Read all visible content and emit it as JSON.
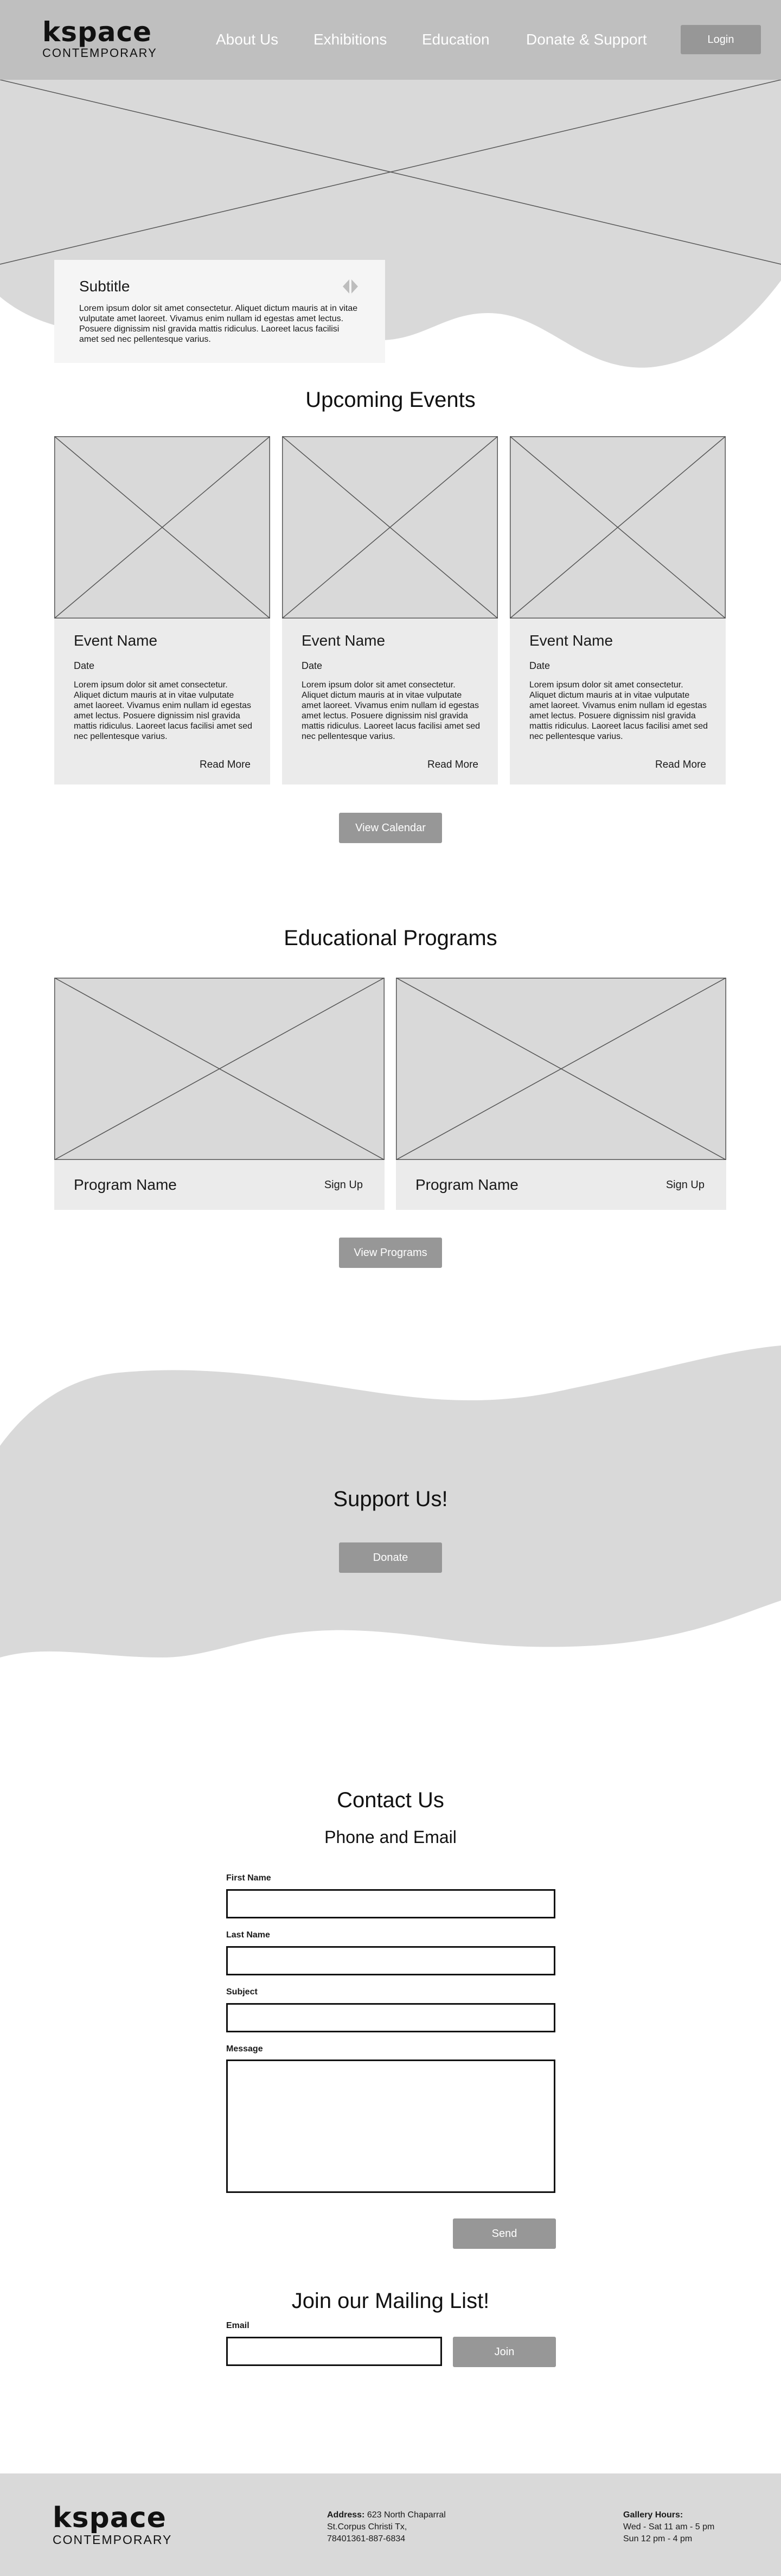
{
  "header": {
    "logo_main": "kspace",
    "logo_sub": "CONTEMPORARY",
    "nav": [
      {
        "label": "About Us"
      },
      {
        "label": "Exhibitions"
      },
      {
        "label": "Education"
      },
      {
        "label": "Donate & Support"
      }
    ],
    "login_label": "Login"
  },
  "hero": {
    "subtitle": "Subtitle",
    "text": "Lorem ipsum dolor sit amet consectetur. Aliquet dictum mauris at in vitae vulputate amet laoreet. Vivamus enim nullam id egestas amet lectus. Posuere dignissim nisl gravida mattis ridiculus. Laoreet lacus facilisi amet sed nec pellentesque varius."
  },
  "events": {
    "title": "Upcoming Events",
    "items": [
      {
        "name": "Event Name",
        "date": "Date",
        "text": "Lorem ipsum dolor sit amet consectetur. Aliquet dictum mauris at in vitae vulputate amet laoreet. Vivamus enim nullam id egestas amet lectus. Posuere dignissim nisl gravida mattis ridiculus. Laoreet lacus facilisi amet sed nec pellentesque varius.",
        "link": "Read More"
      },
      {
        "name": "Event Name",
        "date": "Date",
        "text": "Lorem ipsum dolor sit amet consectetur. Aliquet dictum mauris at in vitae vulputate amet laoreet. Vivamus enim nullam id egestas amet lectus. Posuere dignissim nisl gravida mattis ridiculus. Laoreet lacus facilisi amet sed nec pellentesque varius.",
        "link": "Read More"
      },
      {
        "name": "Event Name",
        "date": "Date",
        "text": "Lorem ipsum dolor sit amet consectetur. Aliquet dictum mauris at in vitae vulputate amet laoreet. Vivamus enim nullam id egestas amet lectus. Posuere dignissim nisl gravida mattis ridiculus. Laoreet lacus facilisi amet sed nec pellentesque varius.",
        "link": "Read More"
      }
    ],
    "button_label": "View Calendar"
  },
  "programs": {
    "title": "Educational Programs",
    "items": [
      {
        "name": "Program Name",
        "link": "Sign Up"
      },
      {
        "name": "Program Name",
        "link": "Sign Up"
      }
    ],
    "button_label": "View Programs"
  },
  "support": {
    "title": "Support Us!",
    "button_label": "Donate"
  },
  "contact": {
    "title": "Contact Us",
    "subtitle": "Phone and Email",
    "fields": {
      "first_name": "First Name",
      "last_name": "Last Name",
      "subject": "Subject",
      "message": "Message"
    },
    "send_label": "Send"
  },
  "mailing": {
    "title": "Join our Mailing List!",
    "email_label": "Email",
    "join_label": "Join"
  },
  "footer": {
    "logo_main": "kspace",
    "logo_sub": "CONTEMPORARY",
    "address_label": "Address:",
    "address_line1": "623 North Chaparral",
    "address_line2": "St.Corpus Christi Tx,",
    "address_line3": "78401361-887-6834",
    "hours_label": "Gallery Hours:",
    "hours_line1": "Wed - Sat 11 am - 5 pm",
    "hours_line2": "Sun 12 pm - 4 pm"
  },
  "colors": {
    "header_bg": "#bfbfbf",
    "placeholder_bg": "#d9d9d9",
    "card_bg": "#ebebeb",
    "button_bg": "#979797",
    "footer_bg": "#d9d9d9"
  }
}
